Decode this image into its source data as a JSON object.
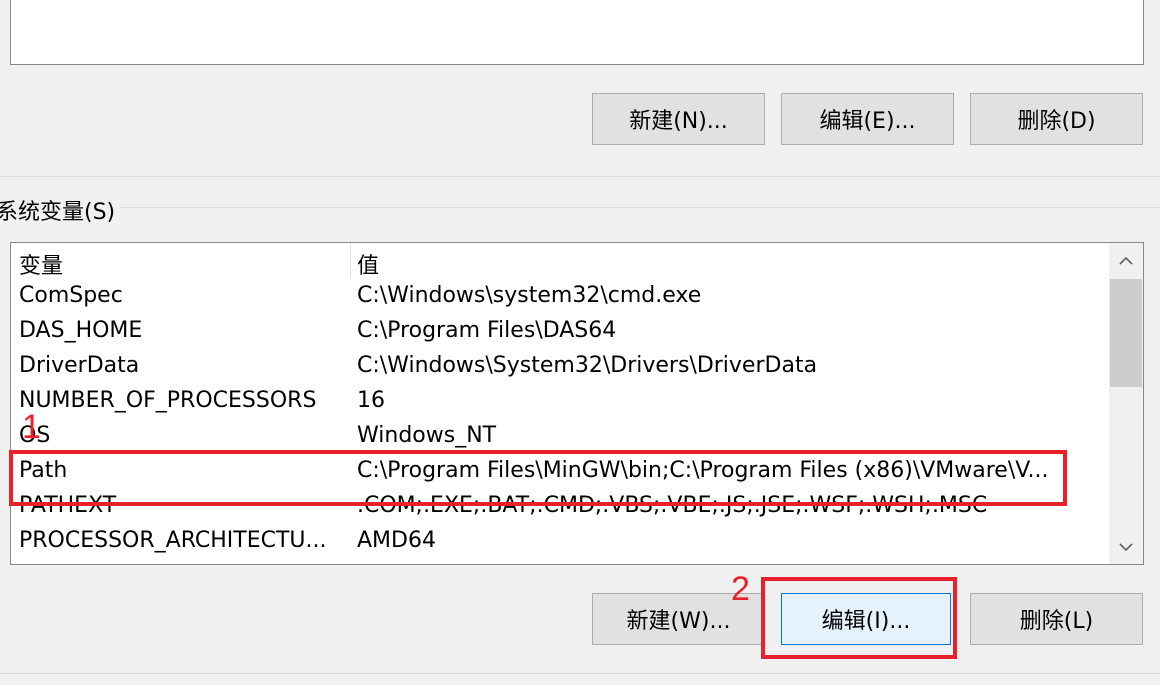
{
  "user_section": {
    "buttons": {
      "new": "新建(N)...",
      "edit": "编辑(E)...",
      "delete": "删除(D)"
    }
  },
  "system_section": {
    "group_label": "系统变量(S)",
    "columns": {
      "variable": "变量",
      "value": "值"
    },
    "rows": [
      {
        "variable": "ComSpec",
        "value": "C:\\Windows\\system32\\cmd.exe"
      },
      {
        "variable": "DAS_HOME",
        "value": "C:\\Program Files\\DAS64"
      },
      {
        "variable": "DriverData",
        "value": "C:\\Windows\\System32\\Drivers\\DriverData"
      },
      {
        "variable": "NUMBER_OF_PROCESSORS",
        "value": "16"
      },
      {
        "variable": "OS",
        "value": "Windows_NT"
      },
      {
        "variable": "Path",
        "value": "C:\\Program Files\\MinGW\\bin;C:\\Program Files (x86)\\VMware\\V..."
      },
      {
        "variable": "PATHEXT",
        "value": ".COM;.EXE;.BAT;.CMD;.VBS;.VBE;.JS;.JSE;.WSF;.WSH;.MSC"
      },
      {
        "variable": "PROCESSOR_ARCHITECTU...",
        "value": "AMD64"
      }
    ],
    "buttons": {
      "new": "新建(W)...",
      "edit": "编辑(I)...",
      "delete": "删除(L)"
    }
  },
  "scrollbar": {
    "up_icon": "chevron-up-icon",
    "down_icon": "chevron-down-icon"
  },
  "annotations": [
    {
      "label": "1",
      "color": "#e8202a",
      "target": "Path row"
    },
    {
      "label": "2",
      "color": "#e8202a",
      "target": "编辑(I)... button"
    }
  ]
}
